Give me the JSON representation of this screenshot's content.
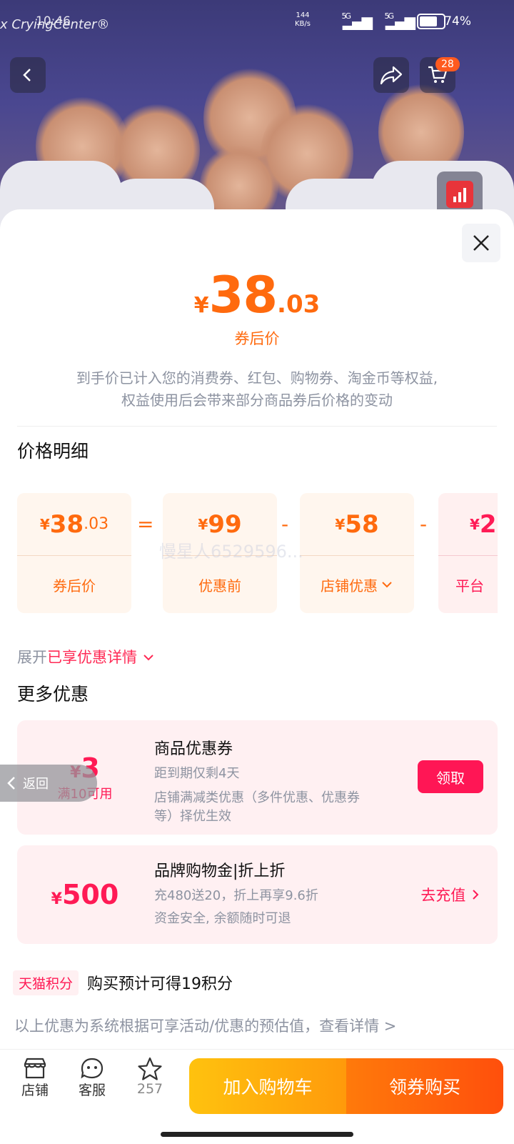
{
  "status_bar": {
    "time": "10:46",
    "watermark": "x CryingCenter®",
    "net_speed_value": "144",
    "net_speed_unit": "KB/s",
    "network1": "5G",
    "network2": "5G",
    "battery": "74%"
  },
  "header": {
    "cart_count": "28"
  },
  "price": {
    "currency": "¥",
    "integer": "38",
    "decimal": ".03",
    "label": "券后价",
    "notice_line1": "到手价已计入您的消费券、红包、购物券、淘金币等权益,",
    "notice_line2": "权益使用后会带来部分商品券后价格的变动"
  },
  "detail": {
    "title": "价格明细",
    "cards": [
      {
        "currency": "¥",
        "integer": "38",
        "decimal": ".03",
        "label": "券后价"
      },
      {
        "currency": "¥",
        "integer": "99",
        "decimal": "",
        "label": "优惠前"
      },
      {
        "currency": "¥",
        "integer": "58",
        "decimal": "",
        "label": "店铺优惠"
      },
      {
        "currency": "¥",
        "integer": "2",
        "decimal": "",
        "label": "平台"
      }
    ],
    "operators": [
      "=",
      "-",
      "-"
    ],
    "watermark": "慢星人6529596..."
  },
  "expand": {
    "prefix": "展开",
    "highlight": "已享优惠详情"
  },
  "more": {
    "title": "更多优惠",
    "coupon": {
      "currency": "¥",
      "amount": "3",
      "condition": "满10可用",
      "title": "商品优惠券",
      "line1": "距到期仅剩4天",
      "line2": "店铺满减类优惠（多件优惠、优惠券",
      "line3": "等）择优生效",
      "button": "领取"
    },
    "brand": {
      "currency": "¥",
      "amount": "500",
      "title": "品牌购物金|折上折",
      "line1": "充480送20，折上再享9.6折",
      "line2": "资金安全, 余额随时可退",
      "action": "去充值"
    }
  },
  "float_back": "返回",
  "points": {
    "tag": "天猫积分",
    "text": "购买预计可得19积分"
  },
  "disclaimer": "以上优惠为系统根据可享活动/优惠的预估值，查看详情 >",
  "bottom": {
    "shop": "店铺",
    "service": "客服",
    "favorite_count": "257",
    "add_cart": "加入购物车",
    "buy": "领券购买"
  },
  "colors": {
    "price_orange": "#ff6a0e",
    "accent_red": "#ff1655"
  }
}
